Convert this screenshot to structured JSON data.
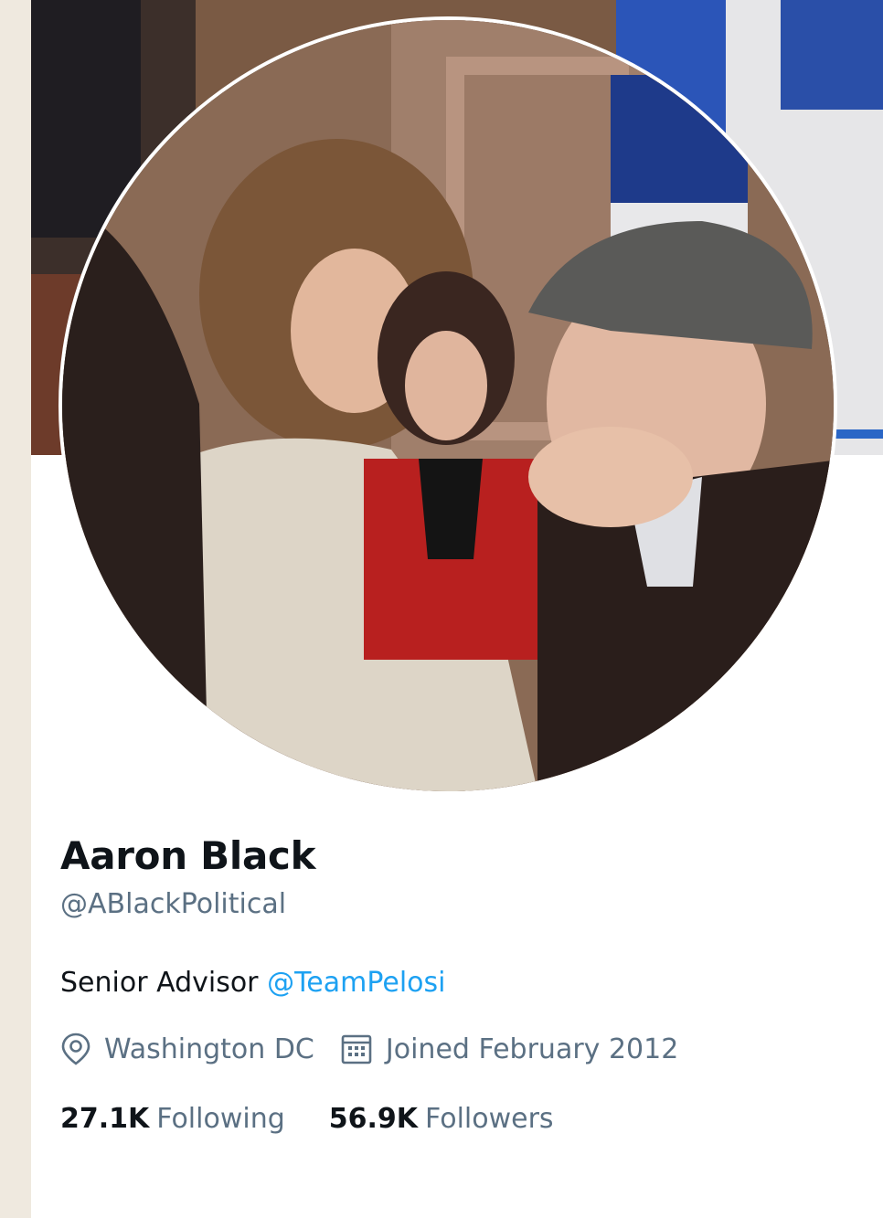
{
  "profile": {
    "display_name": "Aaron Black",
    "handle": "@ABlackPolitical",
    "bio": {
      "text": "Senior Advisor",
      "mention": "@TeamPelosi"
    },
    "location": "Washington DC",
    "joined": "Joined February 2012",
    "following": {
      "count": "27.1K",
      "label": "Following"
    },
    "followers": {
      "count": "56.9K",
      "label": "Followers"
    }
  },
  "icons": {
    "location": "location-pin-icon",
    "joined": "calendar-icon"
  },
  "colors": {
    "link": "#1da1f2",
    "secondary_text": "#5b7083",
    "primary_text": "#0f1419"
  }
}
